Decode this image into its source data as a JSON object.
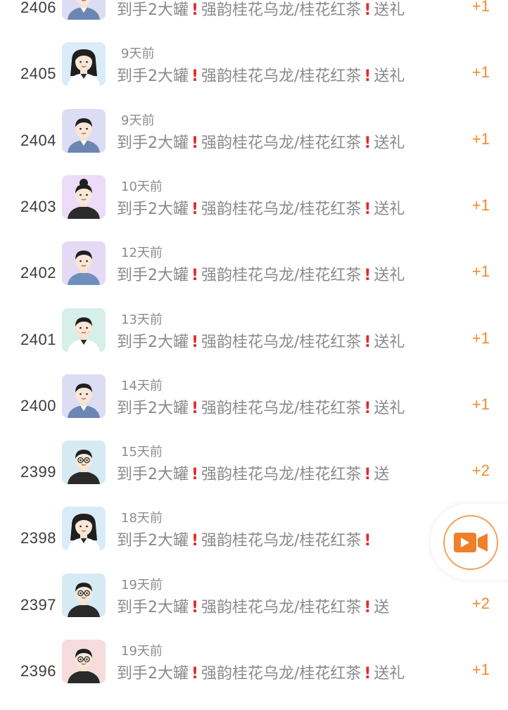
{
  "message": {
    "part1": "到手2大罐",
    "part2": "强韵桂花乌龙/桂花红茶",
    "gift": "送礼",
    "gift_short": "送"
  },
  "rows": [
    {
      "rank": "2406",
      "time": "",
      "plus": "+1",
      "avatar": "woman-short-hair-blue"
    },
    {
      "rank": "2405",
      "time": "9天前",
      "plus": "+1",
      "avatar": "woman-long-hair-white-shirt"
    },
    {
      "rank": "2404",
      "time": "9天前",
      "plus": "+1",
      "avatar": "woman-short-hair-blue"
    },
    {
      "rank": "2403",
      "time": "10天前",
      "plus": "+1",
      "avatar": "woman-bun-dark"
    },
    {
      "rank": "2402",
      "time": "12天前",
      "plus": "+1",
      "avatar": "man-short-hair-blue"
    },
    {
      "rank": "2401",
      "time": "13天前",
      "plus": "+1",
      "avatar": "man-beard-white-shirt"
    },
    {
      "rank": "2400",
      "time": "14天前",
      "plus": "+1",
      "avatar": "woman-short-hair-blue"
    },
    {
      "rank": "2399",
      "time": "15天前",
      "plus": "+2",
      "avatar": "man-glasses-dark"
    },
    {
      "rank": "2398",
      "time": "18天前",
      "plus": "",
      "avatar": "woman-long-hair-white-shirt"
    },
    {
      "rank": "2397",
      "time": "19天前",
      "plus": "+2",
      "avatar": "man-glasses-dark"
    },
    {
      "rank": "2396",
      "time": "19天前",
      "plus": "+1",
      "avatar": "man-curly-glasses"
    }
  ],
  "colors": {
    "accent": "#f08a2c",
    "exclamation": "#e12b2b",
    "muted_text": "#8a8a8a"
  },
  "fab": {
    "icon": "video-camera-icon"
  }
}
